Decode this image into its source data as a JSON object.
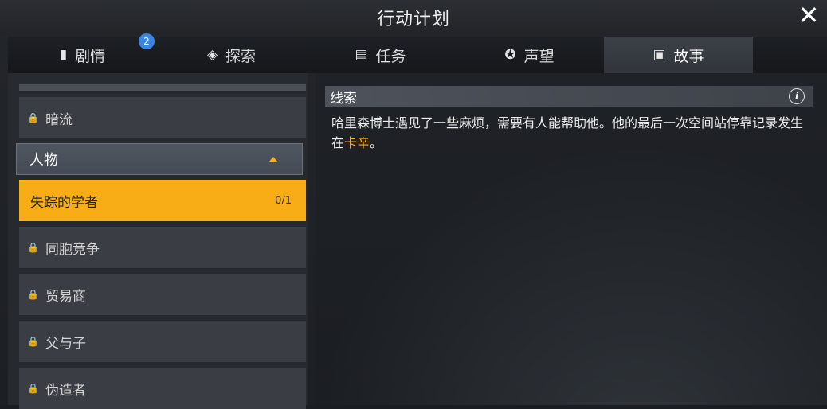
{
  "window": {
    "title": "行动计划",
    "close_icon": "close-icon"
  },
  "tabs": [
    {
      "label": "剧情",
      "icon": "book-icon",
      "badge": "2",
      "active": false
    },
    {
      "label": "探索",
      "icon": "explore-icon",
      "active": false
    },
    {
      "label": "任务",
      "icon": "clipboard-icon",
      "active": false
    },
    {
      "label": "声望",
      "icon": "reputation-icon",
      "active": false
    },
    {
      "label": "故事",
      "icon": "story-icon",
      "active": true
    }
  ],
  "sidebar": {
    "top_item": {
      "label": "暗流",
      "locked": true
    },
    "group": {
      "label": "人物",
      "expanded": true
    },
    "items": [
      {
        "label": "失踪的学者",
        "count": "0/1",
        "selected": true
      },
      {
        "label": "同胞竞争",
        "locked": true
      },
      {
        "label": "贸易商",
        "locked": true
      },
      {
        "label": "父与子",
        "locked": true
      },
      {
        "label": "伪造者",
        "locked": true
      }
    ]
  },
  "clue": {
    "title": "线索",
    "text_before": "哈里森博士遇见了一些麻烦，需要有人能帮助他。他的最后一次空间站停靠记录发生在",
    "highlight": "卡辛",
    "text_after": "。"
  },
  "colors": {
    "accent": "#f8ad16",
    "badge": "#3a86e0"
  }
}
